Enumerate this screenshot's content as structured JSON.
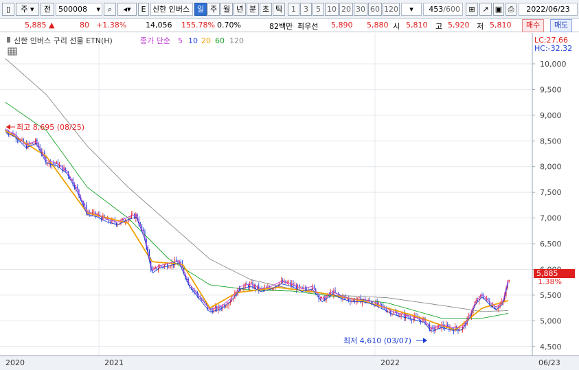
{
  "toolbar": {
    "market_left": "주",
    "symbol_mode": "전",
    "code": "500008",
    "type_label": "E",
    "name": "신한 인버스",
    "periods": [
      "일",
      "주",
      "월",
      "년",
      "분",
      "초",
      "틱"
    ],
    "active_period": "일",
    "intervals": [
      "1",
      "3",
      "5",
      "10",
      "20",
      "30",
      "60",
      "120"
    ],
    "count": "453",
    "count_max": "/600",
    "date": "2022/06/23"
  },
  "quote": {
    "price": "5,885",
    "change": "80",
    "change_pct": "+1.38%",
    "volume": "14,056",
    "volume_ratio": "155.78%",
    "turnover": "0.70%",
    "amount": "82백만",
    "best_bid_label": "최우선",
    "best_ask": "5,890",
    "best_bid": "5,880",
    "open_label": "시",
    "open": "5,810",
    "high_label": "고",
    "high": "5,920",
    "low_label": "저",
    "low": "5,810",
    "buy_button": "매수",
    "sell_button": "매도"
  },
  "colors": {
    "up": "#e01f1f",
    "down": "#1f3fd6",
    "ma5": "#c13bd6",
    "ma20": "#f0a000",
    "ma60": "#19a32a",
    "ma120": "#8a8a8a"
  },
  "chart_data": {
    "type": "candlestick",
    "title": "신한 인버스 구리 선물 ETN(H)",
    "ma_legend": {
      "label": "종가 단순",
      "periods": [
        "5",
        "10",
        "20",
        "60",
        "120"
      ]
    },
    "lc": "LC:27.66",
    "hc": "HC:-32.32",
    "y_ticks": [
      "10,000",
      "9,500",
      "9,000",
      "8,500",
      "8,000",
      "7,500",
      "7,000",
      "6,500",
      "6,000",
      "5,500",
      "5,000",
      "4,500"
    ],
    "ylim": [
      4350,
      10200
    ],
    "x_labels": [
      "2020",
      "2021",
      "2022",
      "06/23"
    ],
    "last_price": "5,885",
    "last_pct": "1.38%",
    "high_annotation": "최고 8,695 (08/25)",
    "low_annotation": "최저 4,610 (03/07)",
    "high_value": 8695,
    "low_value": 4610,
    "close_series": [
      [
        0,
        8700
      ],
      [
        15,
        8600
      ],
      [
        30,
        8400
      ],
      [
        45,
        8480
      ],
      [
        60,
        8100
      ],
      [
        75,
        8050
      ],
      [
        90,
        7900
      ],
      [
        105,
        7550
      ],
      [
        120,
        7100
      ],
      [
        135,
        7050
      ],
      [
        150,
        6950
      ],
      [
        165,
        6900
      ],
      [
        180,
        7000
      ],
      [
        192,
        7050
      ],
      [
        205,
        6600
      ],
      [
        215,
        5950
      ],
      [
        225,
        6050
      ],
      [
        240,
        6100
      ],
      [
        255,
        6150
      ],
      [
        270,
        5700
      ],
      [
        285,
        5450
      ],
      [
        300,
        5200
      ],
      [
        315,
        5250
      ],
      [
        330,
        5400
      ],
      [
        345,
        5650
      ],
      [
        360,
        5700
      ],
      [
        375,
        5600
      ],
      [
        390,
        5650
      ],
      [
        405,
        5750
      ],
      [
        420,
        5700
      ],
      [
        435,
        5600
      ],
      [
        450,
        5650
      ],
      [
        465,
        5400
      ],
      [
        480,
        5550
      ],
      [
        495,
        5450
      ],
      [
        510,
        5400
      ],
      [
        525,
        5400
      ],
      [
        540,
        5350
      ],
      [
        555,
        5250
      ],
      [
        570,
        5150
      ],
      [
        585,
        5100
      ],
      [
        600,
        5050
      ],
      [
        615,
        5000
      ],
      [
        625,
        4820
      ],
      [
        640,
        4900
      ],
      [
        655,
        4850
      ],
      [
        670,
        4850
      ],
      [
        680,
        5050
      ],
      [
        690,
        5350
      ],
      [
        700,
        5500
      ],
      [
        710,
        5350
      ],
      [
        720,
        5250
      ],
      [
        730,
        5350
      ],
      [
        740,
        5885
      ]
    ],
    "ma20_series": [
      [
        0,
        8700
      ],
      [
        60,
        8200
      ],
      [
        120,
        7100
      ],
      [
        180,
        6900
      ],
      [
        215,
        6150
      ],
      [
        260,
        6100
      ],
      [
        300,
        5250
      ],
      [
        340,
        5550
      ],
      [
        400,
        5650
      ],
      [
        460,
        5550
      ],
      [
        520,
        5400
      ],
      [
        600,
        5100
      ],
      [
        660,
        4820
      ],
      [
        700,
        5250
      ],
      [
        740,
        5400
      ]
    ],
    "ma60_series": [
      [
        0,
        9250
      ],
      [
        60,
        8700
      ],
      [
        120,
        7600
      ],
      [
        180,
        7000
      ],
      [
        240,
        6200
      ],
      [
        300,
        5700
      ],
      [
        360,
        5600
      ],
      [
        420,
        5580
      ],
      [
        480,
        5480
      ],
      [
        560,
        5350
      ],
      [
        640,
        5050
      ],
      [
        700,
        5050
      ],
      [
        740,
        5150
      ]
    ],
    "ma120_series": [
      [
        0,
        10100
      ],
      [
        60,
        9400
      ],
      [
        120,
        8400
      ],
      [
        180,
        7600
      ],
      [
        240,
        6900
      ],
      [
        300,
        6200
      ],
      [
        360,
        5800
      ],
      [
        420,
        5620
      ],
      [
        480,
        5500
      ],
      [
        560,
        5450
      ],
      [
        640,
        5300
      ],
      [
        700,
        5180
      ],
      [
        740,
        5200
      ]
    ]
  }
}
